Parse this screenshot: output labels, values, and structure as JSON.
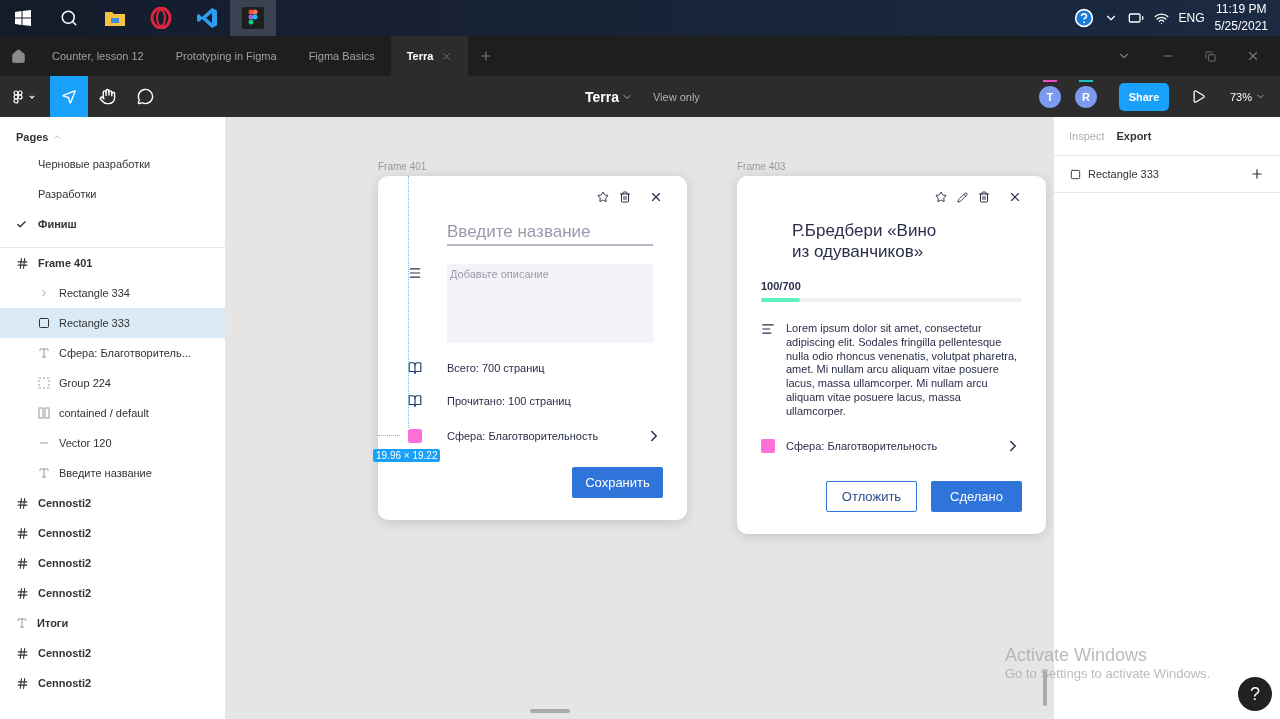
{
  "taskbar": {
    "apps": [
      {
        "kind": "explorer",
        "selected": false
      },
      {
        "kind": "opera",
        "selected": false
      },
      {
        "kind": "vscode",
        "selected": false
      },
      {
        "kind": "figma",
        "selected": true
      }
    ],
    "tray": {
      "language": "ENG",
      "time": "11:19 PM",
      "date": "5/25/2021"
    }
  },
  "tabs": [
    {
      "label": "Counter, lesson 12",
      "selected": false
    },
    {
      "label": "Prototyping in Figma",
      "selected": false
    },
    {
      "label": "Figma Basics",
      "selected": false
    },
    {
      "label": "Terra",
      "selected": true
    }
  ],
  "toolbar": {
    "tools": [
      {
        "kind": "move",
        "selected": true
      },
      {
        "kind": "hand",
        "selected": false
      },
      {
        "kind": "comment",
        "selected": false
      }
    ],
    "file_title": "Terra",
    "mode": "View only",
    "users": [
      {
        "initial": "T",
        "color": "#e94fc4"
      },
      {
        "initial": "R",
        "color": "#1bc4c4"
      }
    ],
    "share": "Share",
    "zoom": "73%"
  },
  "pages": {
    "title": "Pages",
    "items": [
      {
        "label": "Черновые разработки",
        "selected": false
      },
      {
        "label": "Разработки",
        "selected": false
      },
      {
        "label": "Финиш",
        "selected": true
      }
    ]
  },
  "layers": [
    {
      "name": "Frame 401",
      "kind": "frame",
      "selected": false,
      "children": [
        {
          "name": "Rectangle 334",
          "kind": "chevron",
          "selected": false
        },
        {
          "name": "Rectangle 333",
          "kind": "rect",
          "selected": true
        },
        {
          "name": "Сфера: Благотворитель...",
          "kind": "text",
          "selected": false
        },
        {
          "name": "Group 224",
          "kind": "group",
          "selected": false
        },
        {
          "name": "contained / default",
          "kind": "component",
          "selected": false
        },
        {
          "name": "Vector 120",
          "kind": "vector",
          "selected": false
        },
        {
          "name": "Введите название",
          "kind": "text",
          "selected": false
        }
      ]
    },
    {
      "name": "Cennosti2",
      "kind": "frame",
      "selected": false
    },
    {
      "name": "Cennosti2",
      "kind": "frame",
      "selected": false
    },
    {
      "name": "Cennosti2",
      "kind": "frame",
      "selected": false
    },
    {
      "name": "Cennosti2",
      "kind": "frame",
      "selected": false
    },
    {
      "name": "Итоги",
      "kind": "text",
      "selected": false
    },
    {
      "name": "Cennosti2",
      "kind": "frame",
      "selected": false
    },
    {
      "name": "Cennosti2",
      "kind": "frame",
      "selected": false
    }
  ],
  "frames": [
    {
      "label": "Frame 401",
      "kind": "edit",
      "title_placeholder": "Введите название",
      "description_placeholder": "Добавьте описание",
      "total": "Всего: 700 страниц",
      "read": "Прочитано: 100 страниц",
      "sphere": "Сфера: Благотворительность",
      "buttons": [
        {
          "label": "Сохранить",
          "kind": "primary"
        }
      ],
      "measure": "19.96 × 19.22"
    },
    {
      "label": "Frame 403",
      "kind": "view",
      "title": "Р.Бредбери «Вино из одуванчиков»",
      "progress_text": "100/700",
      "level": 0.15,
      "description": "Lorem ipsum dolor sit amet, consectetur adipiscing elit. Sodales fringilla pellentesque nulla odio rhoncus venenatis, volutpat pharetra, amet. Mi nullam arcu aliquam vitae posuere lacus, massa ullamcorper. Mi nullam arcu aliquam vitae posuere lacus, massa ullamcorper.",
      "sphere": "Сфера: Благотворительность",
      "buttons": [
        {
          "label": "Отложить",
          "kind": "secondary"
        },
        {
          "label": "Сделано",
          "kind": "primary"
        }
      ]
    }
  ],
  "right_panel": {
    "tabs": [
      {
        "label": "Inspect",
        "selected": false
      },
      {
        "label": "Export",
        "selected": true
      }
    ],
    "layer": "Rectangle 333"
  },
  "help_button": "?",
  "os_notice": {
    "title": "Activate Windows",
    "subtitle": "Go to Settings to activate Windows."
  }
}
